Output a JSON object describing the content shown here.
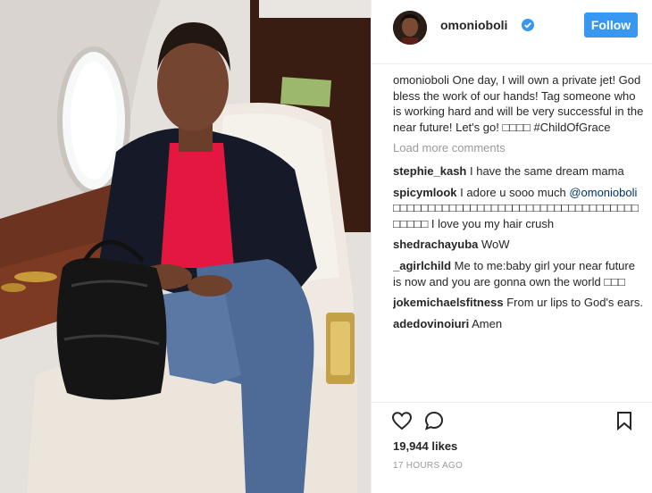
{
  "post": {
    "username": "omonioboli",
    "verified": true,
    "follow_label": "Follow",
    "caption": {
      "user": "omonioboli",
      "text": "One day, I will own a private jet! God bless the work of our hands! Tag someone who is working hard and will be very successful in the near future! Let's go! □□□□ ",
      "hashtag": "#ChildOfGrace"
    },
    "load_more": "Load more comments",
    "comments": [
      {
        "user": "stephie_kash",
        "text": "I have the same dream mama"
      },
      {
        "user": "spicymlook",
        "text": "I adore u sooo much",
        "mention": "@omonioboli",
        "rest": "□□□□□□□□□□□□□□□□□□□□□□□□□□□□□□□□□□□□□□□□ I love you my hair crush"
      },
      {
        "user": "shedrachayuba",
        "text": "WoW"
      },
      {
        "user": "_agirlchild",
        "text": "Me to me:baby girl your near future is now and you are gonna own the world □□□"
      },
      {
        "user": "jokemichaelsfitness",
        "text": "From ur lips to God's ears."
      },
      {
        "user": "adedovinoiuri",
        "text": "Amen"
      }
    ],
    "likes": "19,944 likes",
    "time": "17 HOURS AGO",
    "icons": {
      "like": "heart-icon",
      "comment": "comment-bubble-icon",
      "save": "bookmark-icon",
      "verified": "verified-badge-icon"
    },
    "colors": {
      "accent": "#3897f0",
      "mention": "#003569",
      "muted": "#999999"
    }
  }
}
